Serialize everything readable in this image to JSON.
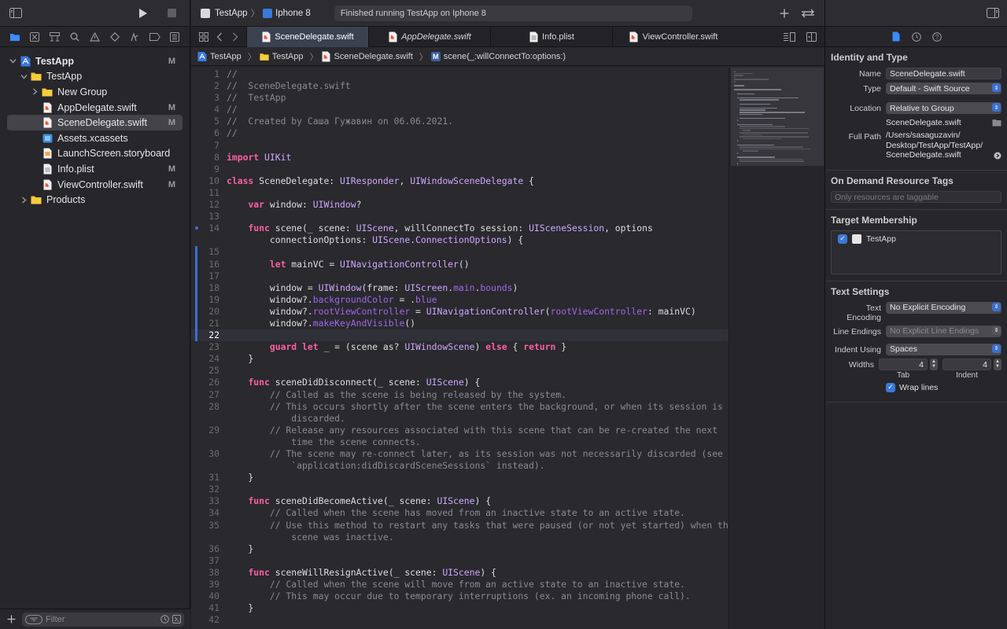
{
  "navigator": {
    "tree": [
      {
        "label": "TestApp",
        "badge": "M",
        "indent": 0,
        "disclosure": "open",
        "icon": "project-icon"
      },
      {
        "label": "TestApp",
        "badge": "",
        "indent": 1,
        "disclosure": "open",
        "icon": "folder-icon"
      },
      {
        "label": "New Group",
        "badge": "",
        "indent": 2,
        "disclosure": "closed",
        "icon": "folder-icon"
      },
      {
        "label": "AppDelegate.swift",
        "badge": "M",
        "indent": 2,
        "disclosure": "none",
        "icon": "swift-file-icon"
      },
      {
        "label": "SceneDelegate.swift",
        "badge": "M",
        "indent": 2,
        "disclosure": "none",
        "icon": "swift-file-icon",
        "selected": true
      },
      {
        "label": "Assets.xcassets",
        "badge": "",
        "indent": 2,
        "disclosure": "none",
        "icon": "assets-icon"
      },
      {
        "label": "LaunchScreen.storyboard",
        "badge": "",
        "indent": 2,
        "disclosure": "none",
        "icon": "storyboard-icon"
      },
      {
        "label": "Info.plist",
        "badge": "M",
        "indent": 2,
        "disclosure": "none",
        "icon": "plist-icon"
      },
      {
        "label": "ViewController.swift",
        "badge": "M",
        "indent": 2,
        "disclosure": "none",
        "icon": "swift-file-icon"
      },
      {
        "label": "Products",
        "badge": "",
        "indent": 1,
        "disclosure": "closed",
        "icon": "folder-icon"
      }
    ],
    "filter_placeholder": "Filter"
  },
  "toolbar": {
    "scheme": "TestApp",
    "device": "Iphone 8",
    "status": "Finished running TestApp on Iphone 8"
  },
  "tabs": [
    {
      "label": "SceneDelegate.swift",
      "active": true,
      "italic": false
    },
    {
      "label": "AppDelegate.swift",
      "active": false,
      "italic": true
    },
    {
      "label": "Info.plist",
      "active": false,
      "italic": false
    },
    {
      "label": "ViewController.swift",
      "active": false,
      "italic": false
    }
  ],
  "jumpbar": {
    "crumbs": [
      "TestApp",
      "TestApp",
      "SceneDelegate.swift"
    ],
    "symbol_badge": "M",
    "symbol": "scene(_:willConnectTo:options:)"
  },
  "code": {
    "current_line": 22,
    "changed_lines": [
      15,
      16,
      17,
      18,
      19,
      20,
      21,
      22
    ],
    "breakpoint_dot_line": 14,
    "lines": [
      {
        "n": "1",
        "t": "//"
      },
      {
        "n": "2",
        "t": "//  SceneDelegate.swift"
      },
      {
        "n": "3",
        "t": "//  TestApp"
      },
      {
        "n": "4",
        "t": "//"
      },
      {
        "n": "5",
        "t": "//  Created by Саша Гужавин on 06.06.2021."
      },
      {
        "n": "6",
        "t": "//"
      },
      {
        "n": "7",
        "t": ""
      },
      {
        "n": "8",
        "t": "import UIKit"
      },
      {
        "n": "9",
        "t": ""
      },
      {
        "n": "10",
        "t": "class SceneDelegate: UIResponder, UIWindowSceneDelegate {"
      },
      {
        "n": "11",
        "t": ""
      },
      {
        "n": "12",
        "t": "    var window: UIWindow?"
      },
      {
        "n": "13",
        "t": ""
      },
      {
        "n": "14",
        "t": "    func scene(_ scene: UIScene, willConnectTo session: UISceneSession, options"
      },
      {
        "n": "",
        "t": "        connectionOptions: UIScene.ConnectionOptions) {"
      },
      {
        "n": "15",
        "t": ""
      },
      {
        "n": "16",
        "t": "        let mainVC = UINavigationController()"
      },
      {
        "n": "17",
        "t": ""
      },
      {
        "n": "18",
        "t": "        window = UIWindow(frame: UIScreen.main.bounds)"
      },
      {
        "n": "19",
        "t": "        window?.backgroundColor = .blue"
      },
      {
        "n": "20",
        "t": "        window?.rootViewController = UINavigationController(rootViewController: mainVC)"
      },
      {
        "n": "21",
        "t": "        window?.makeKeyAndVisible()"
      },
      {
        "n": "22",
        "t": ""
      },
      {
        "n": "23",
        "t": "        guard let _ = (scene as? UIWindowScene) else { return }"
      },
      {
        "n": "24",
        "t": "    }"
      },
      {
        "n": "25",
        "t": ""
      },
      {
        "n": "26",
        "t": "    func sceneDidDisconnect(_ scene: UIScene) {"
      },
      {
        "n": "27",
        "t": "        // Called as the scene is being released by the system."
      },
      {
        "n": "28",
        "t": "        // This occurs shortly after the scene enters the background, or when its session is"
      },
      {
        "n": "",
        "t": "            discarded."
      },
      {
        "n": "29",
        "t": "        // Release any resources associated with this scene that can be re-created the next"
      },
      {
        "n": "",
        "t": "            time the scene connects."
      },
      {
        "n": "30",
        "t": "        // The scene may re-connect later, as its session was not necessarily discarded (see"
      },
      {
        "n": "",
        "t": "            `application:didDiscardSceneSessions` instead)."
      },
      {
        "n": "31",
        "t": "    }"
      },
      {
        "n": "32",
        "t": ""
      },
      {
        "n": "33",
        "t": "    func sceneDidBecomeActive(_ scene: UIScene) {"
      },
      {
        "n": "34",
        "t": "        // Called when the scene has moved from an inactive state to an active state."
      },
      {
        "n": "35",
        "t": "        // Use this method to restart any tasks that were paused (or not yet started) when the"
      },
      {
        "n": "",
        "t": "            scene was inactive."
      },
      {
        "n": "36",
        "t": "    }"
      },
      {
        "n": "37",
        "t": ""
      },
      {
        "n": "38",
        "t": "    func sceneWillResignActive(_ scene: UIScene) {"
      },
      {
        "n": "39",
        "t": "        // Called when the scene will move from an active state to an inactive state."
      },
      {
        "n": "40",
        "t": "        // This may occur due to temporary interruptions (ex. an incoming phone call)."
      },
      {
        "n": "41",
        "t": "    }"
      },
      {
        "n": "42",
        "t": ""
      }
    ]
  },
  "inspector": {
    "identity": {
      "title": "Identity and Type",
      "name_label": "Name",
      "name_value": "SceneDelegate.swift",
      "type_label": "Type",
      "type_value": "Default - Swift Source",
      "location_label": "Location",
      "location_value": "Relative to Group",
      "location_file": "SceneDelegate.swift",
      "fullpath_label": "Full Path",
      "fullpath_value": "/Users/sasaguzavin/\nDesktop/TestApp/TestApp/\nSceneDelegate.swift"
    },
    "resource_tags": {
      "title": "On Demand Resource Tags",
      "placeholder": "Only resources are taggable"
    },
    "membership": {
      "title": "Target Membership",
      "target": "TestApp",
      "checked": true
    },
    "text_settings": {
      "title": "Text Settings",
      "encoding_label": "Text Encoding",
      "encoding_value": "No Explicit Encoding",
      "endings_label": "Line Endings",
      "endings_value": "No Explicit Line Endings",
      "indent_label": "Indent Using",
      "indent_value": "Spaces",
      "widths_label": "Widths",
      "tab_value": "4",
      "tab_label": "Tab",
      "indent_width_value": "4",
      "indent_width_label": "Indent",
      "wrap_label": "Wrap lines",
      "wrap_checked": true
    }
  },
  "colors": {
    "accent": "#3b79d8",
    "keyword": "#fc5fa3",
    "comment": "#8a8a93",
    "type": "#d0a8ff",
    "function": "#67b7a4",
    "declaration": "#5dd8ff"
  }
}
